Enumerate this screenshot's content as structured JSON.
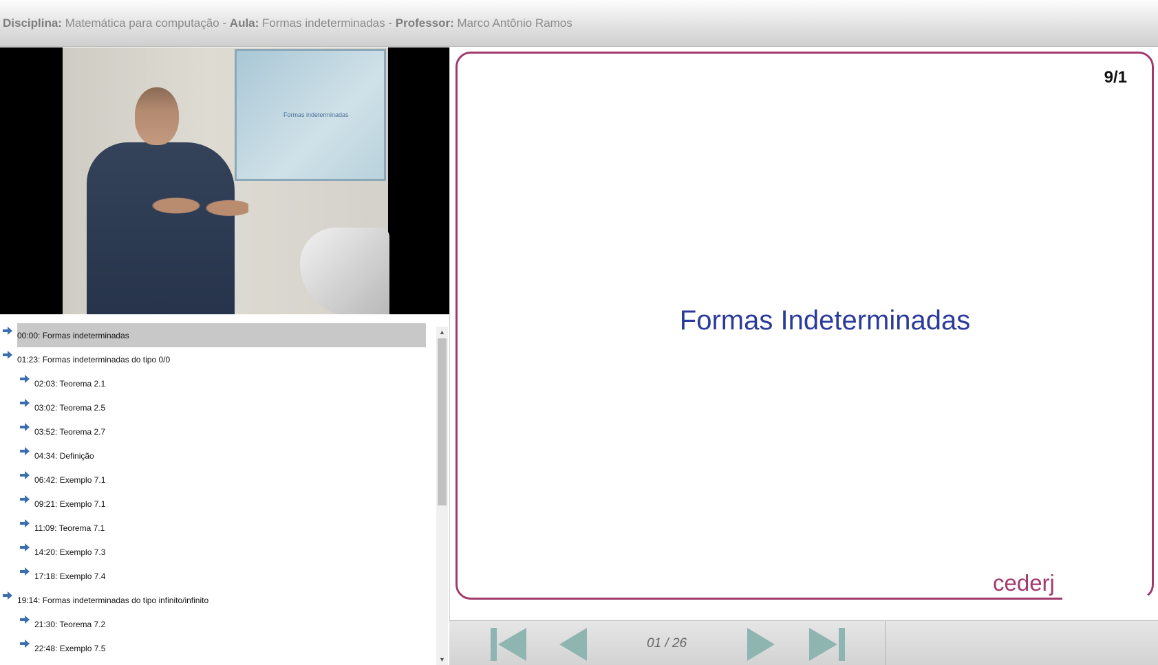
{
  "header": {
    "discipline_label": "Disciplina:",
    "discipline_value": "Matemática para computação",
    "separator": "-",
    "class_label": "Aula:",
    "class_value": "Formas indeterminadas",
    "professor_label": "Professor:",
    "professor_value": "Marco Antônio Ramos"
  },
  "video": {
    "screen_text": "Formas indeterminadas"
  },
  "chapters": [
    {
      "label": "00:00: Formas indeterminadas",
      "level": 0,
      "active": true
    },
    {
      "label": "01:23: Formas indeterminadas do tipo 0/0",
      "level": 0,
      "active": false
    },
    {
      "label": "02:03: Teorema 2.1",
      "level": 1,
      "active": false
    },
    {
      "label": "03:02: Teorema 2.5",
      "level": 1,
      "active": false
    },
    {
      "label": "03:52: Teorema 2.7",
      "level": 1,
      "active": false
    },
    {
      "label": "04:34: Definição",
      "level": 1,
      "active": false
    },
    {
      "label": "06:42: Exemplo 7.1",
      "level": 1,
      "active": false
    },
    {
      "label": "09:21: Exemplo 7.1",
      "level": 1,
      "active": false
    },
    {
      "label": "11:09: Teorema 7.1",
      "level": 1,
      "active": false
    },
    {
      "label": "14:20: Exemplo 7.3",
      "level": 1,
      "active": false
    },
    {
      "label": "17:18: Exemplo 7.4",
      "level": 1,
      "active": false
    },
    {
      "label": "19:14: Formas indeterminadas do tipo infinito/infinito",
      "level": 0,
      "active": false
    },
    {
      "label": "21:30: Teorema 7.2",
      "level": 1,
      "active": false
    },
    {
      "label": "22:48: Exemplo 7.5",
      "level": 1,
      "active": false
    }
  ],
  "slide": {
    "number": "9/1",
    "title": "Formas Indeterminadas",
    "logo": "cederj"
  },
  "controls": {
    "page_counter": "01 / 26"
  },
  "colors": {
    "slide_border": "#a13a6c",
    "slide_title": "#2a3b9a",
    "arrow": "#3a6fb0",
    "active_chapter": "#c8c8c8",
    "control_icon": "#8fb5b0"
  },
  "icons": {
    "chapter_arrow": "arrow-right-icon",
    "first": "skip-first-icon",
    "prev": "previous-icon",
    "next": "next-icon",
    "last": "skip-last-icon"
  }
}
